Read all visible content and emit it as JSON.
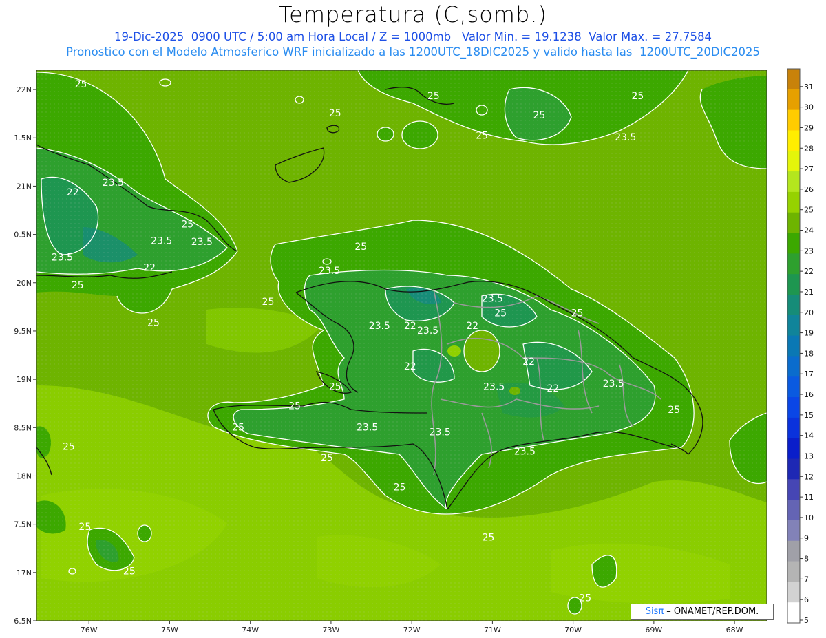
{
  "title": "Temperatura (C,somb.)",
  "subtitle_line1": "19-Dic-2025  0900 UTC / 5:00 am Hora Local / Z = 1000mb   Valor Min. = 19.1238  Valor Max. = 27.7584",
  "subtitle_line2": "Pronostico con el Modelo Atmosferico WRF inicializado a las 1200UTC_18DIC2025 y valido hasta las  1200UTC_20DIC2025",
  "credit": {
    "brand": "Sisπ",
    "text": " – ONAMET/REP.DOM."
  },
  "map": {
    "lat_range": [
      16.5,
      22.2
    ],
    "lon_range": [
      -76.65,
      -67.6
    ],
    "lat_ticks": [
      {
        "value": 22.0,
        "label": "22N"
      },
      {
        "value": 21.5,
        "label": "1.5N"
      },
      {
        "value": 21.0,
        "label": "21N"
      },
      {
        "value": 20.5,
        "label": "0.5N"
      },
      {
        "value": 20.0,
        "label": "20N"
      },
      {
        "value": 19.5,
        "label": "9.5N"
      },
      {
        "value": 19.0,
        "label": "19N"
      },
      {
        "value": 18.5,
        "label": "8.5N"
      },
      {
        "value": 18.0,
        "label": "18N"
      },
      {
        "value": 17.5,
        "label": "7.5N"
      },
      {
        "value": 17.0,
        "label": "17N"
      },
      {
        "value": 16.5,
        "label": "6.5N"
      }
    ],
    "lon_ticks": [
      {
        "value": -76,
        "label": "76W"
      },
      {
        "value": -75,
        "label": "75W"
      },
      {
        "value": -74,
        "label": "74W"
      },
      {
        "value": -73,
        "label": "73W"
      },
      {
        "value": -72,
        "label": "72W"
      },
      {
        "value": -71,
        "label": "71W"
      },
      {
        "value": -70,
        "label": "70W"
      },
      {
        "value": -69,
        "label": "69W"
      },
      {
        "value": -68,
        "label": "68W"
      }
    ],
    "contour_labels": [
      {
        "label": "25",
        "lon": -76.1,
        "lat": 22.05
      },
      {
        "label": "25",
        "lon": -72.95,
        "lat": 21.75
      },
      {
        "label": "25",
        "lon": -71.73,
        "lat": 21.93
      },
      {
        "label": "25",
        "lon": -70.42,
        "lat": 21.73
      },
      {
        "label": "25",
        "lon": -69.2,
        "lat": 21.93
      },
      {
        "label": "23.5",
        "lon": -69.35,
        "lat": 21.5
      },
      {
        "label": "25",
        "lon": -71.13,
        "lat": 21.52
      },
      {
        "label": "23.5",
        "lon": -75.7,
        "lat": 21.03
      },
      {
        "label": "22",
        "lon": -76.2,
        "lat": 20.93
      },
      {
        "label": "25",
        "lon": -74.78,
        "lat": 20.6
      },
      {
        "label": "23.5",
        "lon": -75.1,
        "lat": 20.43
      },
      {
        "label": "23.5",
        "lon": -74.6,
        "lat": 20.42
      },
      {
        "label": "23.5",
        "lon": -76.33,
        "lat": 20.26
      },
      {
        "label": "22",
        "lon": -75.25,
        "lat": 20.15
      },
      {
        "label": "25",
        "lon": -76.14,
        "lat": 19.97
      },
      {
        "label": "25",
        "lon": -75.2,
        "lat": 19.58
      },
      {
        "label": "25",
        "lon": -72.63,
        "lat": 20.37
      },
      {
        "label": "23.5",
        "lon": -73.02,
        "lat": 20.12
      },
      {
        "label": "25",
        "lon": -73.78,
        "lat": 19.8
      },
      {
        "label": "23.5",
        "lon": -71.0,
        "lat": 19.83
      },
      {
        "label": "25",
        "lon": -70.9,
        "lat": 19.68
      },
      {
        "label": "25",
        "lon": -69.95,
        "lat": 19.68
      },
      {
        "label": "23.5",
        "lon": -72.4,
        "lat": 19.55
      },
      {
        "label": "22",
        "lon": -72.02,
        "lat": 19.55
      },
      {
        "label": "23.5",
        "lon": -71.8,
        "lat": 19.5
      },
      {
        "label": "22",
        "lon": -71.25,
        "lat": 19.55
      },
      {
        "label": "22",
        "lon": -72.02,
        "lat": 19.13
      },
      {
        "label": "22",
        "lon": -70.55,
        "lat": 19.18
      },
      {
        "label": "25",
        "lon": -72.95,
        "lat": 18.92
      },
      {
        "label": "23.5",
        "lon": -70.98,
        "lat": 18.92
      },
      {
        "label": "22",
        "lon": -70.25,
        "lat": 18.9
      },
      {
        "label": "23.5",
        "lon": -69.5,
        "lat": 18.95
      },
      {
        "label": "25",
        "lon": -73.45,
        "lat": 18.72
      },
      {
        "label": "25",
        "lon": -74.15,
        "lat": 18.5
      },
      {
        "label": "23.5",
        "lon": -72.55,
        "lat": 18.5
      },
      {
        "label": "23.5",
        "lon": -71.65,
        "lat": 18.45
      },
      {
        "label": "25",
        "lon": -68.75,
        "lat": 18.68
      },
      {
        "label": "25",
        "lon": -76.25,
        "lat": 18.3
      },
      {
        "label": "25",
        "lon": -73.05,
        "lat": 18.18
      },
      {
        "label": "23.5",
        "lon": -70.6,
        "lat": 18.25
      },
      {
        "label": "25",
        "lon": -72.15,
        "lat": 17.88
      },
      {
        "label": "25",
        "lon": -76.05,
        "lat": 17.47
      },
      {
        "label": "25",
        "lon": -71.05,
        "lat": 17.36
      },
      {
        "label": "25",
        "lon": -75.5,
        "lat": 17.01
      },
      {
        "label": "25",
        "lon": -69.85,
        "lat": 16.73
      }
    ]
  },
  "colorbar": {
    "labels": [
      "31",
      "30",
      "29",
      "28",
      "27",
      "26",
      "25",
      "24",
      "23",
      "22",
      "21",
      "20",
      "19",
      "18",
      "17",
      "16",
      "15",
      "14",
      "13",
      "12",
      "11",
      "10",
      "9",
      "8",
      "7",
      "6",
      "5"
    ],
    "colors": [
      "#c8820a",
      "#e6a000",
      "#ffcc00",
      "#ffee00",
      "#e4f50a",
      "#b4e61e",
      "#96d200",
      "#6eb400",
      "#3ca800",
      "#2ea02e",
      "#1e9650",
      "#168c78",
      "#10849a",
      "#0a78b4",
      "#0a6ccd",
      "#0a5ae0",
      "#0a46e6",
      "#0a32dc",
      "#0a1eca",
      "#1e28b4",
      "#4646b4",
      "#6464b4",
      "#8282b8",
      "#a0a0a8",
      "#b4b4b4",
      "#d2d2d2",
      "#ffffff"
    ]
  }
}
